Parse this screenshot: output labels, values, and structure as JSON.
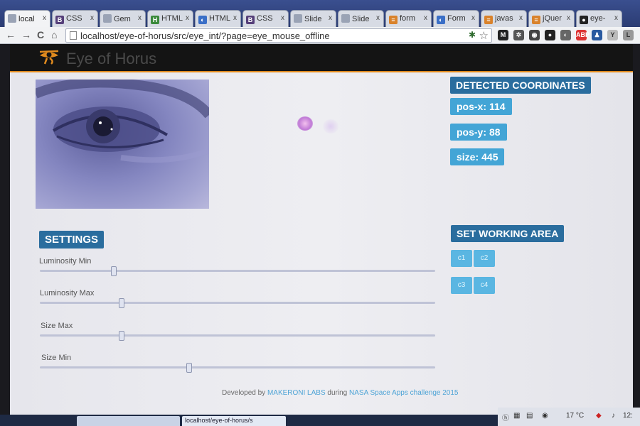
{
  "browser": {
    "tabs": [
      {
        "label": "local",
        "icon": "page-icon",
        "active": true
      },
      {
        "label": "CSS",
        "icon": "bootstrap-icon"
      },
      {
        "label": "Gem",
        "icon": "page-icon"
      },
      {
        "label": "HTML",
        "icon": "html-icon"
      },
      {
        "label": "HTML",
        "icon": "loading-icon"
      },
      {
        "label": "CSS",
        "icon": "bootstrap-icon"
      },
      {
        "label": "Slide",
        "icon": "page-icon"
      },
      {
        "label": "Slide",
        "icon": "page-icon"
      },
      {
        "label": "form",
        "icon": "stackoverflow-icon"
      },
      {
        "label": "Form",
        "icon": "loading-icon"
      },
      {
        "label": "javas",
        "icon": "stackoverflow-icon"
      },
      {
        "label": "jQuer",
        "icon": "stackoverflow-icon"
      },
      {
        "label": "eye-",
        "icon": "github-icon"
      }
    ],
    "tab_close": "x",
    "url": "localhost/eye-of-horus/src/eye_int/?page=eye_mouse_offline",
    "nav": {
      "back": "←",
      "forward": "→",
      "reload": "C",
      "home": "⌂"
    },
    "extensions": [
      "M",
      "✲",
      "◉",
      "●",
      "◐",
      "ABP",
      "♟",
      "Y",
      "L"
    ]
  },
  "app": {
    "title": "Eye of Horus",
    "accent_color": "#e08a1e"
  },
  "detected": {
    "heading": "DETECTED COORDINATES",
    "pos_x_label": "pos-x:",
    "pos_x_value": "114",
    "pos_y_label": "pos-y:",
    "pos_y_value": "88",
    "size_label": "size:",
    "size_value": "445"
  },
  "settings": {
    "heading": "SETTINGS",
    "sliders": [
      {
        "label": "Luminosity Min",
        "level": 0.18
      },
      {
        "label": "Luminosity Max",
        "level": 0.2
      },
      {
        "label": "Size Max",
        "level": 0.2
      },
      {
        "label": "Size Min",
        "level": 0.37
      }
    ]
  },
  "working_area": {
    "heading": "SET WORKING AREA",
    "buttons": [
      "c1",
      "c2",
      "c3",
      "c4"
    ]
  },
  "footer": {
    "prefix": "Developed by",
    "org": "MAKERONI LABS",
    "middle": "during",
    "event": "NASA Space Apps challenge 2015"
  },
  "taskbar": {
    "items": [
      "",
      "localhost/eye-of-horus/s"
    ],
    "temperature": "17 °C",
    "clock": "12:"
  }
}
